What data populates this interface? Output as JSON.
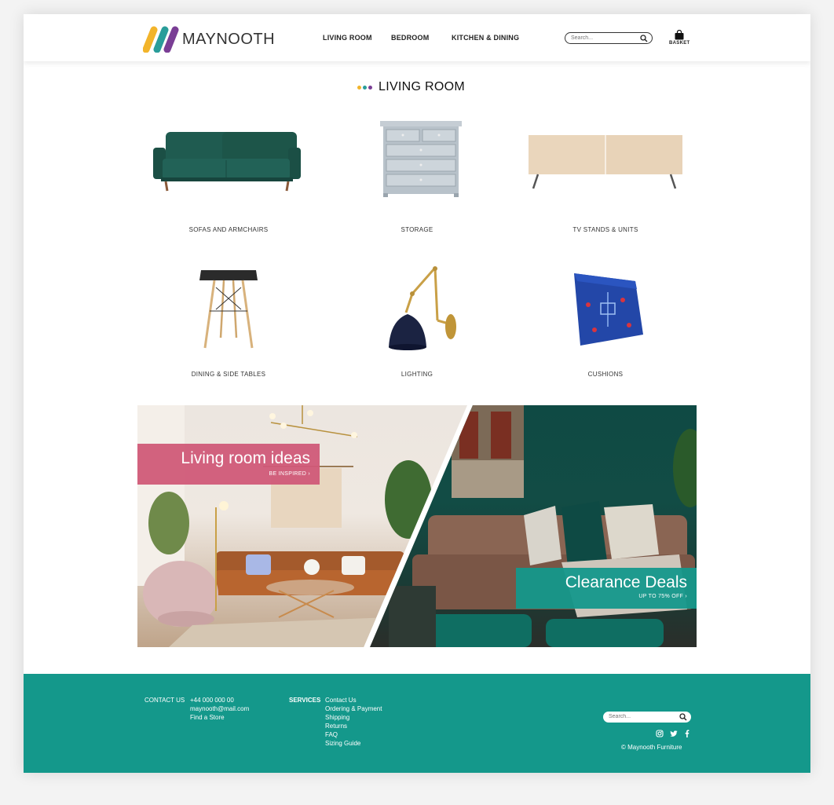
{
  "brand": {
    "name": "MAYNOOTH",
    "colors": {
      "yellow": "#f2b42b",
      "teal": "#2a9d9a",
      "purple": "#6b3a8f",
      "accent": "#14988b",
      "pink": "#d05a78"
    }
  },
  "nav": {
    "items": [
      "LIVING ROOM",
      "BEDROOM",
      "KITCHEN & DINING"
    ]
  },
  "search": {
    "placeholder": "Search..."
  },
  "basket": {
    "label": "BASKET",
    "icon": "shopping-bag-icon"
  },
  "section": {
    "title": "LIVING ROOM"
  },
  "categories": [
    {
      "label": "SOFAS AND ARMCHAIRS",
      "icon": "sofa-image"
    },
    {
      "label": "STORAGE",
      "icon": "dresser-image"
    },
    {
      "label": "TV STANDS & UNITS",
      "icon": "tv-stand-image"
    },
    {
      "label": "DINING & SIDE TABLES",
      "icon": "side-table-image"
    },
    {
      "label": "LIGHTING",
      "icon": "wall-lamp-image"
    },
    {
      "label": "CUSHIONS",
      "icon": "cushion-image"
    }
  ],
  "promos": {
    "left": {
      "title": "Living room ideas",
      "link": "BE INSPIRED ›"
    },
    "right": {
      "title": "Clearance Deals",
      "link": "UP TO 75% OFF ›"
    }
  },
  "footer": {
    "contact": {
      "heading": "CONTACT US",
      "phone": "+44 000 000 00",
      "email": "maynooth@mail.com",
      "store": "Find a Store"
    },
    "services": {
      "heading": "SERVICES",
      "links": [
        "Contact Us",
        "Ordering & Payment",
        "Shipping",
        "Returns",
        "FAQ",
        "Sizing Guide"
      ]
    },
    "search_placeholder": "Search...",
    "social": [
      "instagram-icon",
      "twitter-icon",
      "facebook-icon"
    ],
    "copyright": "©  Maynooth Furniture"
  }
}
